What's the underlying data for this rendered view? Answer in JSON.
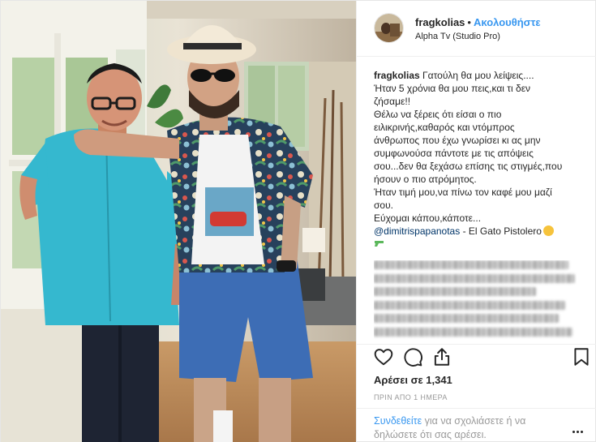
{
  "post": {
    "username": "fragkolias",
    "separator": "•",
    "follow_label": "Ακολουθήστε",
    "location": "Alpha Tv (Studio Pro)",
    "caption": {
      "username": "fragkolias",
      "lines": [
        "Γατούλη θα μου λείψεις....",
        "Ήταν 5 χρόνια θα μου πεις,και τι δεν",
        "ζήσαμε!!",
        "Θέλω να ξέρεις ότι είσαι ο πιο",
        "ειλικρινής,καθαρός και ντόμπρος",
        "άνθρωπος που έχω γνωρίσει κι ας μην",
        "συμφωνούσα πάντοτε με τις απόψεις",
        "σου...δεν θα ξεχάσω επίσης τις στιγμές,που",
        "ήσουν ο πιο ατρόμητος.",
        "Ήταν τιμή μου,να πίνω τον καφέ μου μαζί",
        "σου.",
        "Εύχομαι κάπου,κάποτε..."
      ],
      "mention": "@dimitrispapanotas",
      "mention_suffix": " - El Gato Pistolero",
      "emoji_icons": [
        "cat-face-emoji",
        "water-pistol-emoji"
      ]
    },
    "likes_text": "Αρέσει σε 1,341",
    "timestamp": "ΠΡΙΝ ΑΠΟ 1 ΗΜΕΡΑ",
    "login_prompt": {
      "link": "Συνδεθείτε",
      "text": " για να σχολιάσετε ή να δηλώσετε ότι σας αρέσει."
    },
    "icons": {
      "like": "heart-icon",
      "comment": "comment-icon",
      "share": "share-icon",
      "save": "bookmark-icon",
      "more": "more-options-icon"
    },
    "colors": {
      "link_blue": "#3897f0",
      "mention_blue": "#003569",
      "text": "#262626",
      "muted": "#999999",
      "border": "#efefef"
    }
  }
}
